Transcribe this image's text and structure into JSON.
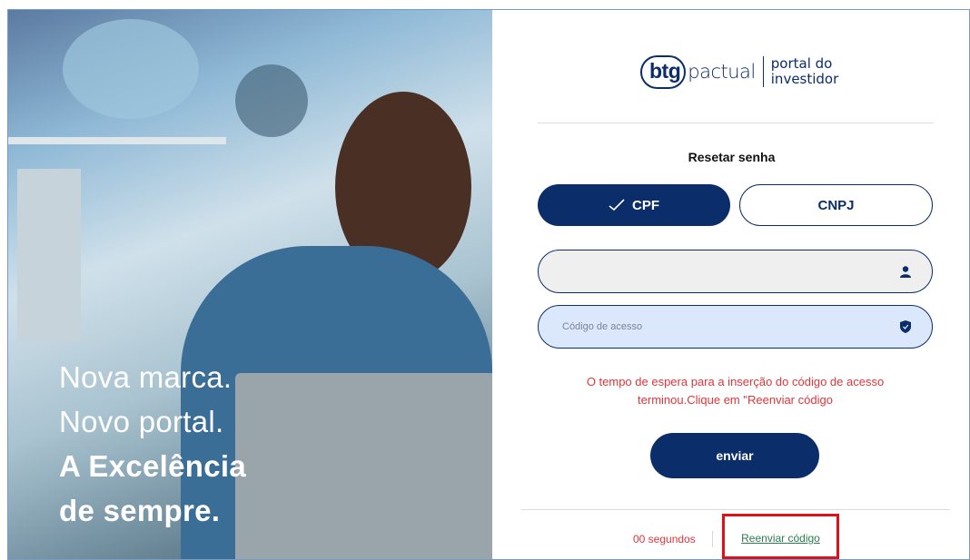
{
  "hero": {
    "line1": "Nova marca.",
    "line2": "Novo portal.",
    "line3": "A Excelência",
    "line4": "de sempre."
  },
  "logo": {
    "btg": "btg",
    "pactual": "pactual",
    "portal_line1": "portal do",
    "portal_line2": "investidor"
  },
  "form": {
    "title": "Resetar senha",
    "tab_cpf": "CPF",
    "tab_cnpj": "CNPJ",
    "cpf_value": "",
    "code_placeholder": "Código de acesso",
    "error": "O tempo de espera para a inserção do código de acesso terminou.Clique em \"Reenviar código",
    "send_label": "enviar"
  },
  "footer": {
    "timer": "00 segundos",
    "resend": "Reenviar código"
  },
  "colors": {
    "brand": "#0b2d6a",
    "error": "#e0353b",
    "link": "#2a7d4f",
    "highlight_box": "#e0101a"
  },
  "icons": {
    "tab_cpf": "check-icon",
    "cpf_field": "user-icon",
    "code_field": "shield-icon"
  }
}
